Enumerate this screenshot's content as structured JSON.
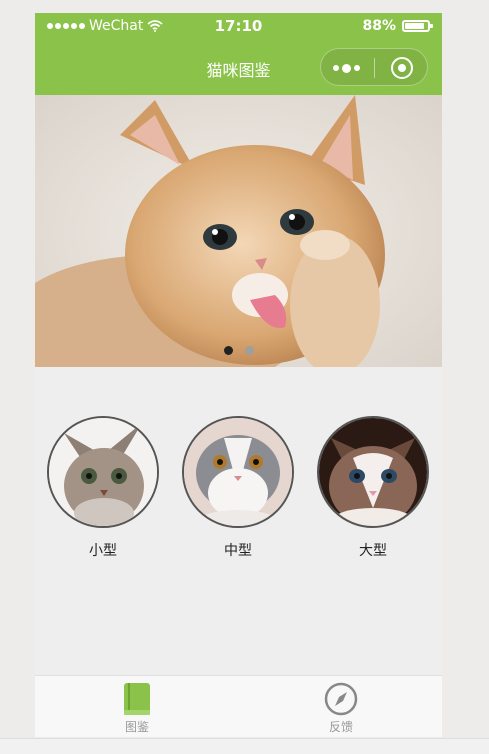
{
  "status_bar": {
    "carrier": "WeChat",
    "time": "17:10",
    "battery": "88%",
    "battery_level": 0.88
  },
  "nav": {
    "title": "猫咪图鉴",
    "more_icon": "more-dots-icon",
    "close_icon": "target-close-icon"
  },
  "banner": {
    "image": "orange-kitten-licking-paw",
    "indicator_count": 2,
    "active_index": 0
  },
  "categories": [
    {
      "label": "小型",
      "image": "small-cat-photo"
    },
    {
      "label": "中型",
      "image": "medium-cat-photo"
    },
    {
      "label": "大型",
      "image": "large-cat-photo"
    }
  ],
  "tabbar": {
    "tabs": [
      {
        "label": "图鉴",
        "icon": "book-icon",
        "active": true
      },
      {
        "label": "反馈",
        "icon": "compass-icon",
        "active": false
      }
    ],
    "accent": "#8bc34a"
  },
  "colors": {
    "header_bg": "#8bc34a",
    "page_bg": "#eeeeee"
  }
}
